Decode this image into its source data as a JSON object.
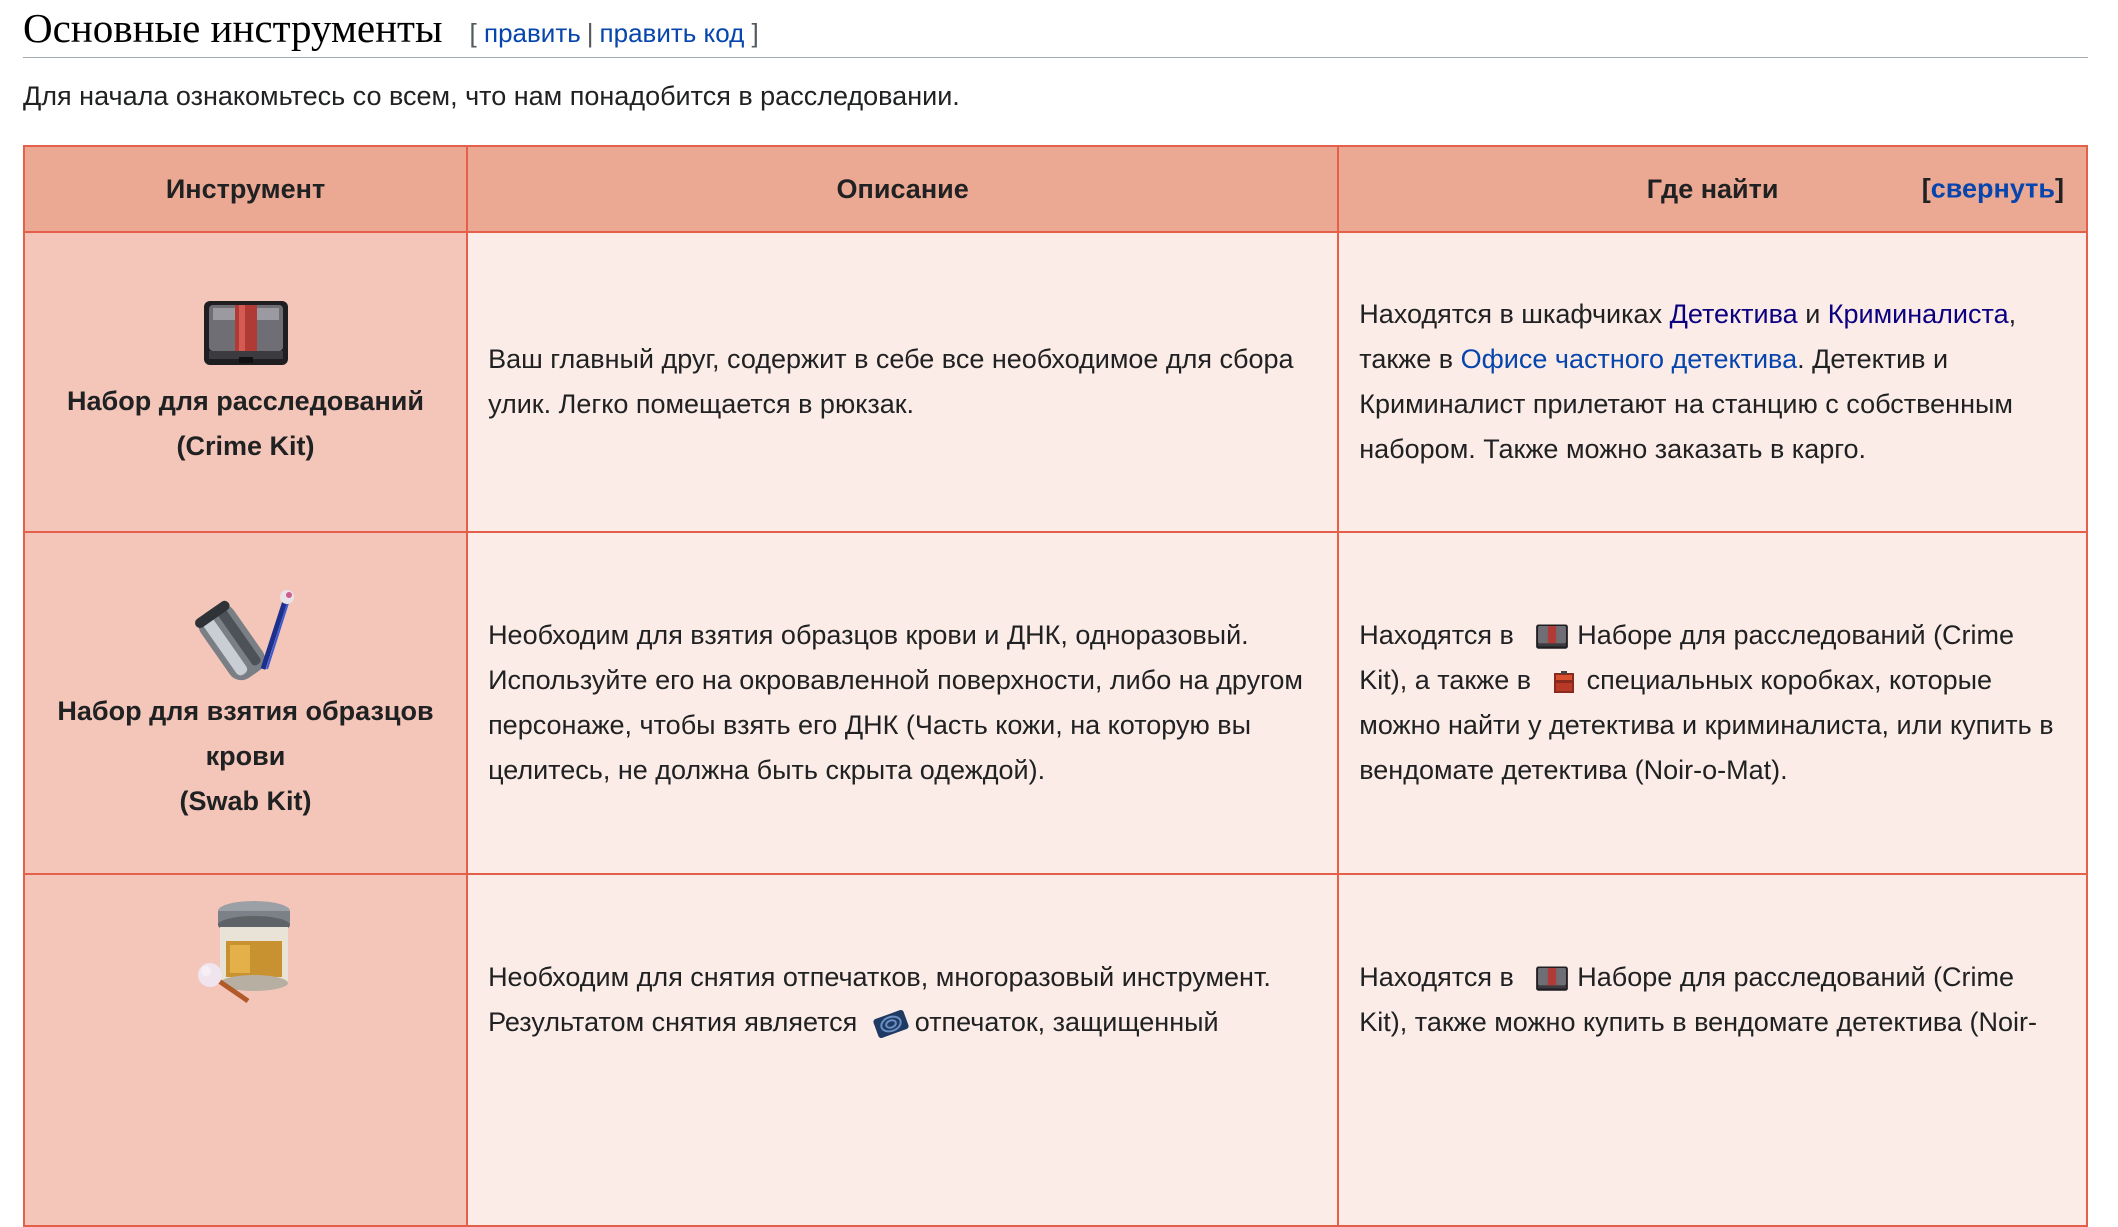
{
  "heading": {
    "title": "Основные инструменты",
    "bracket_open": "[",
    "edit": "править",
    "separator": "|",
    "edit_code": "править код",
    "bracket_close": "]"
  },
  "intro": "Для начала ознакомьтесь со всем, что нам понадобится в расследовании.",
  "table": {
    "headers": [
      "Инструмент",
      "Описание",
      "Где найти"
    ],
    "collapse": {
      "open": "[",
      "label": "свернуть",
      "close": "]"
    },
    "rows": [
      {
        "tool_icon": "crime-kit-icon",
        "tool_name": "Набор для расследований",
        "tool_name_en": "(Crime Kit)",
        "description": "Ваш главный друг, содержит в себе все необходимое для сбора улик. Легко помещается в рюкзак.",
        "where": {
          "t1": "Находятся в шкафчиках ",
          "link1": "Детектива",
          "t2": " и ",
          "link2": "Криминалиста",
          "t3": ", также в ",
          "link3": "Офисе частного детектива",
          "t4": ". Детектив и Криминалист прилетают на станцию с собственным набором. Также можно заказать в карго."
        }
      },
      {
        "tool_icon": "swab-kit-icon",
        "tool_name": "Набор для взятия образцов крови",
        "tool_name_en": "(Swab Kit)",
        "description": "Необходим для взятия образцов крови и ДНК, одноразовый. Используйте его на окровавленной поверхности, либо на другом персонаже, чтобы взять его ДНК (Часть кожи, на которую вы целитесь, не должна быть скрыта одеждой).",
        "where": {
          "t1": "Находятся в ",
          "t2": "Наборе для расследований (Crime Kit), а также в ",
          "t3": "специальных коробках, которые можно найти у детектива и криминалиста, или купить в вендомате детектива (Noir-o-Mat)."
        }
      },
      {
        "tool_icon": "fingerprint-powder-icon",
        "tool_name": "",
        "tool_name_en": "",
        "description_t1": "Необходим для снятия отпечатков, многоразовый инструмент. Результатом снятия является ",
        "description_t2": "отпечаток, защищенный",
        "where": {
          "t1": "Находятся в ",
          "t2": "Наборе для расследований (Crime Kit), также можно купить в вендомате детектива (Noir-"
        }
      }
    ]
  },
  "colors": {
    "header_bg": "#eba893",
    "tool_cell_bg": "#f4c6b9",
    "cell_bg": "#fbece7",
    "border": "#e4604a",
    "link": "#0645ad",
    "visited_link": "#0b0080"
  }
}
